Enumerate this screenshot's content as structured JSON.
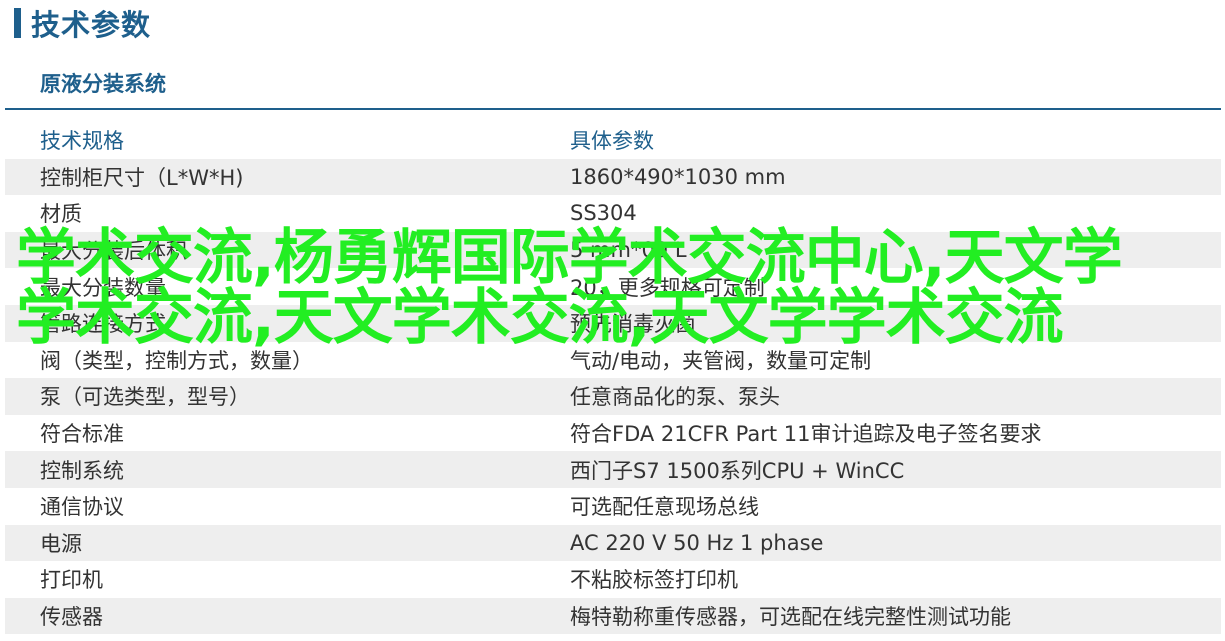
{
  "header": {
    "title": "技术参数",
    "subtitle": "原液分装系统"
  },
  "table": {
    "columns": [
      "技术规格",
      "具体参数"
    ],
    "rows": [
      [
        "控制柜尺寸（L*W*H)",
        "1860*490*1030 mm"
      ],
      [
        "材质",
        "SS304"
      ],
      [
        "最大分装后体积",
        "5 mm*00 L"
      ],
      [
        "最大分装数量",
        "20，更多规格可定制"
      ],
      [
        "管路连接方式",
        "预先消毒灭菌"
      ],
      [
        "阀（类型，控制方式，数量）",
        "气动/电动，夹管阀，数量可定制"
      ],
      [
        "泵（可选类型，型号）",
        "任意商品化的泵、泵头"
      ],
      [
        "符合标准",
        "符合FDA 21CFR Part 11审计追踪及电子签名要求"
      ],
      [
        "控制系统",
        "西门子S7 1500系列CPU + WinCC"
      ],
      [
        "通信协议",
        "可选配任意现场总线"
      ],
      [
        "电源",
        "AC 220 V 50 Hz 1 phase"
      ],
      [
        "打印机",
        "不粘胶标签打印机"
      ],
      [
        "传感器",
        "梅特勒称重传感器，可选配在线完整性测试功能"
      ]
    ]
  },
  "watermark": {
    "text": "学术交流,杨勇辉国际学术交流中心,天文学学术交流,天文学术交流,天文学学术交流",
    "color": "#22ee22"
  },
  "colors": {
    "accent": "#1e5f8c",
    "row_stripe": "#eeeeee",
    "text": "#333333"
  }
}
